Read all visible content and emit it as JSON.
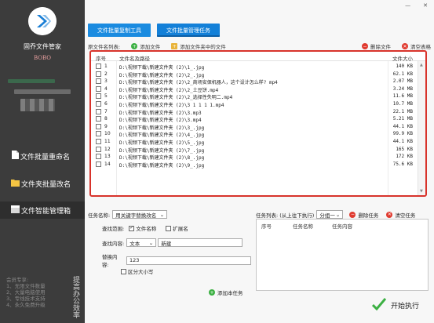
{
  "sidebar": {
    "app_name": "固乔文件管家",
    "user_name": "BOBO",
    "nav": [
      {
        "label": "文件批量重命名",
        "icon": "file-icon"
      },
      {
        "label": "文件夹批量改名",
        "icon": "folder-icon"
      },
      {
        "label": "文件智能管理箱",
        "icon": "box-icon"
      }
    ],
    "promo_lines": [
      "会员专享:",
      "1、无限文件数量",
      "2、大量电脑使用",
      "3、专线技术支持",
      "4、永久免费升级"
    ],
    "promo_vertical": "提高办公效率"
  },
  "window": {
    "minimize": "—",
    "close": "✕"
  },
  "tabs": [
    "文件批量复制工具",
    "文件批量管理任务"
  ],
  "toolbar": {
    "list_label": "原文件名列表:",
    "add_file": "添加文件",
    "add_folder": "添加文件夹中的文件",
    "delete_file": "删除文件",
    "clear_list": "清空表格",
    "colors": {
      "add": "#3cb043",
      "delete": "#e03a2f",
      "folder": "#e8b33a"
    }
  },
  "file_table": {
    "headers": [
      "序号",
      "文件名及路径",
      "文件大小"
    ],
    "rows": [
      {
        "no": "1",
        "path": "D:\\视频下载\\新建文件夹 (2)\\1_.jpg",
        "size": "140 KB"
      },
      {
        "no": "2",
        "path": "D:\\视频下载\\新建文件夹 (2)\\2_.jpg",
        "size": "62.1 KB"
      },
      {
        "no": "3",
        "path": "D:\\视频下载\\新建文件夹 (2)\\2_商场安保机器人，这个设计怎么样? mp4",
        "size": "2.07 MB"
      },
      {
        "no": "4",
        "path": "D:\\视频下载\\新建文件夹 (2)\\2_土豆饼.mp4",
        "size": "3.24 MB"
      },
      {
        "no": "5",
        "path": "D:\\视频下载\\新建文件夹 (2)\\2_选择性失明二.mp4",
        "size": "11.6 MB"
      },
      {
        "no": "6",
        "path": "D:\\视频下载\\新建文件夹 (2)\\3 1 1 1 1.mp4",
        "size": "10.7 MB"
      },
      {
        "no": "7",
        "path": "D:\\视频下载\\新建文件夹 (2)\\3.mp3",
        "size": "22.1 MB"
      },
      {
        "no": "8",
        "path": "D:\\视频下载\\新建文件夹 (2)\\3.mp4",
        "size": "5.21 MB"
      },
      {
        "no": "9",
        "path": "D:\\视频下载\\新建文件夹 (2)\\3_.jpg",
        "size": "44.1 KB"
      },
      {
        "no": "10",
        "path": "D:\\视频下载\\新建文件夹 (2)\\4_.jpg",
        "size": "99.9 KB"
      },
      {
        "no": "11",
        "path": "D:\\视频下载\\新建文件夹 (2)\\5_.jpg",
        "size": "44.1 KB"
      },
      {
        "no": "12",
        "path": "D:\\视频下载\\新建文件夹 (2)\\7_.jpg",
        "size": "165 KB"
      },
      {
        "no": "13",
        "path": "D:\\视频下载\\新建文件夹 (2)\\8_.jpg",
        "size": "172 KB"
      },
      {
        "no": "14",
        "path": "D:\\视频下载\\新建文件夹 (2)\\9_.jpg",
        "size": "75.6 KB"
      }
    ]
  },
  "task_form": {
    "task_name_label": "任务名称:",
    "task_name_value": "用关键字替换改名",
    "scope_label": "查找范围:",
    "scope_filename": "文件名称",
    "scope_ext": "扩展名",
    "find_label": "查找内容:",
    "find_type": "文本",
    "find_value": "新建",
    "replace_label": "替换内容:",
    "replace_value": "123",
    "case_label": "区分大小写",
    "add_task": "添加本任务"
  },
  "task_list": {
    "label": "任务列表: (从上往下执行)",
    "mode": "分组一",
    "delete_task": "删除任务",
    "clear_task": "清空任务",
    "headers": [
      "序号",
      "任务名称",
      "任务内容"
    ],
    "start": "开始执行"
  }
}
